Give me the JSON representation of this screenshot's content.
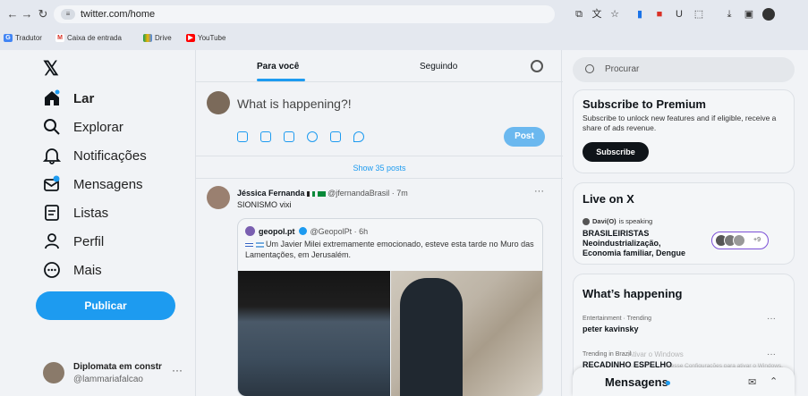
{
  "browser": {
    "url": "twitter.com/home",
    "bookmarks": [
      {
        "label": "Tradutor",
        "icon": "translate-icon"
      },
      {
        "label": "Caixa de entrada",
        "icon": "gmail-icon"
      },
      {
        "label": "Drive",
        "icon": "drive-icon"
      },
      {
        "label": "YouTube",
        "icon": "youtube-icon"
      }
    ]
  },
  "sidebar": {
    "items": [
      {
        "label": "Lar",
        "icon": "home-icon"
      },
      {
        "label": "Explorar",
        "icon": "search-icon"
      },
      {
        "label": "Notificações",
        "icon": "bell-icon"
      },
      {
        "label": "Mensagens",
        "icon": "envelope-icon"
      },
      {
        "label": "Listas",
        "icon": "list-icon"
      },
      {
        "label": "Perfil",
        "icon": "person-icon"
      },
      {
        "label": "Mais",
        "icon": "more-circle-icon"
      }
    ],
    "publish_label": "Publicar",
    "account": {
      "name": "Diplomata em constr",
      "handle": "@lammariafalcao",
      "more": "···"
    }
  },
  "feed": {
    "tabs": [
      "Para você",
      "Seguindo"
    ],
    "compose_placeholder": "What is happening?!",
    "post_label": "Post",
    "show_posts": "Show 35 posts",
    "tweet": {
      "name": "Jéssica Fernanda",
      "meta": "@jfernandaBrasil · 7m",
      "text": "SIONISMO vixi",
      "more": "···",
      "quote": {
        "name": "geopol.pt",
        "meta": "@GeopolPt · 6h",
        "text": "Um Javier Milei extremamente emocionado, esteve esta tarde no Muro das Lamentações, em Jerusalém."
      }
    }
  },
  "right": {
    "search_placeholder": "Procurar",
    "premium": {
      "title": "Subscribe to Premium",
      "desc": "Subscribe to unlock new features and if eligible, receive a share of ads revenue.",
      "button": "Subscribe"
    },
    "live": {
      "title": "Live on X",
      "speaker": "Davi(O)",
      "speaking": "is speaking",
      "space_title": "BRASILEIRISTAS",
      "space_line2": "Neoindustrialização,",
      "space_line3": "Economia familiar, Dengue",
      "count": "+9"
    },
    "happening": {
      "title": "What’s happening",
      "trends": [
        {
          "category": "Entertainment · Trending",
          "name": "peter kavinsky"
        },
        {
          "category": "Trending in Brazil",
          "name": "RECADINHO ESPELHO"
        }
      ]
    },
    "dm_label": "Mensagens",
    "watermark": "Ativar o Windows",
    "watermark_sub": "Acesse Configurações para ativar o Windows."
  }
}
